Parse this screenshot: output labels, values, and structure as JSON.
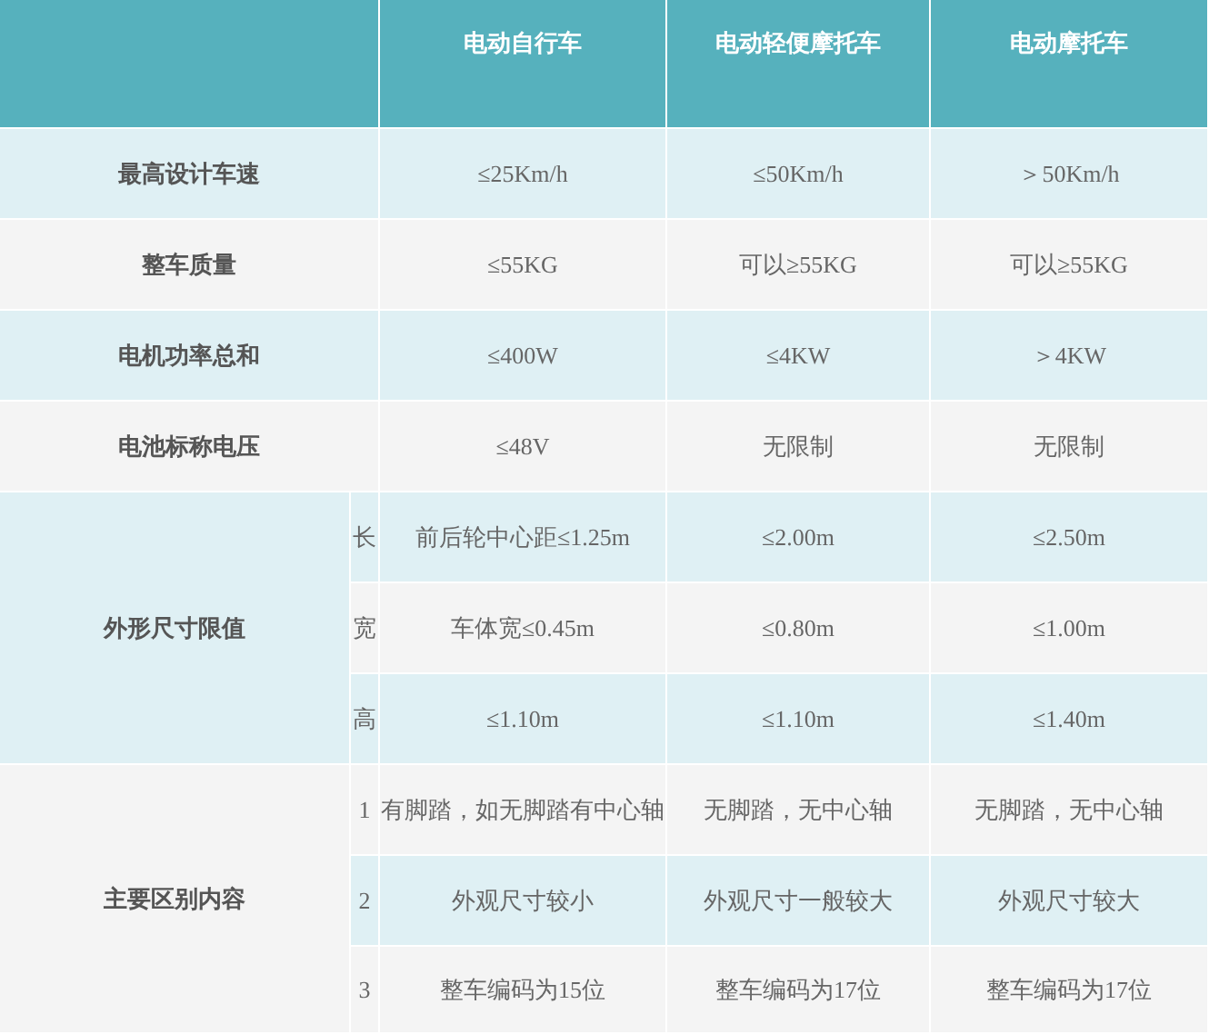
{
  "table": {
    "columns": [
      "电动自行车",
      "电动轻便摩托车",
      "电动摩托车"
    ],
    "rows": [
      {
        "kind": "simple",
        "label": "最高设计车速",
        "values": [
          "≤25Km/h",
          "≤50Km/h",
          "＞50Km/h"
        ]
      },
      {
        "kind": "simple",
        "label": "整车质量",
        "values": [
          "≤55KG",
          "可以≥55KG",
          "可以≥55KG"
        ]
      },
      {
        "kind": "simple",
        "label": "电机功率总和",
        "values": [
          "≤400W",
          "≤4KW",
          "＞4KW"
        ]
      },
      {
        "kind": "simple",
        "label": "电池标称电压",
        "values": [
          "≤48V",
          "无限制",
          "无限制"
        ]
      },
      {
        "kind": "group",
        "label": "外形尺寸限值",
        "subrows": [
          {
            "marker": "长",
            "values": [
              "前后轮中心距≤1.25m",
              "≤2.00m",
              "≤2.50m"
            ]
          },
          {
            "marker": "宽",
            "values": [
              "车体宽≤0.45m",
              "≤0.80m",
              "≤1.00m"
            ]
          },
          {
            "marker": "高",
            "values": [
              "≤1.10m",
              "≤1.10m",
              "≤1.40m"
            ]
          }
        ]
      },
      {
        "kind": "group",
        "label": "主要区别内容",
        "subrows": [
          {
            "marker": "1",
            "values": [
              "有脚踏，如无脚踏有中心轴",
              "无脚踏，无中心轴",
              "无脚踏，无中心轴"
            ]
          },
          {
            "marker": "2",
            "values": [
              "外观尺寸较小",
              "外观尺寸一般较大",
              "外观尺寸较大"
            ]
          },
          {
            "marker": "3",
            "values": [
              "整车编码为15位",
              "整车编码为17位",
              "整车编码为17位"
            ]
          }
        ]
      }
    ]
  }
}
